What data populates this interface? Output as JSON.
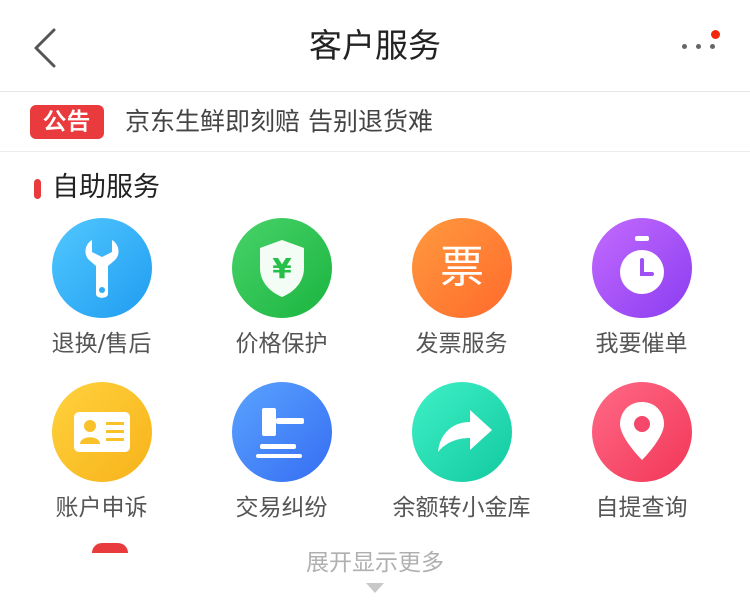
{
  "header": {
    "title": "客户服务",
    "back_icon": "chevron-left-icon",
    "more_icon": "more-dots-icon",
    "badge_color": "#f2270c"
  },
  "notice": {
    "tag": "公告",
    "text": "京东生鲜即刻赔 告别退货难",
    "tag_color": "#e93b3d"
  },
  "section": {
    "title": "自助服务",
    "accent_color": "#e93b3d"
  },
  "services": [
    {
      "label": "退换/售后",
      "icon": "wrench-icon",
      "color": "#2fadf5"
    },
    {
      "label": "价格保护",
      "icon": "shield-yuan-icon",
      "color": "#26bf4a"
    },
    {
      "label": "发票服务",
      "icon": "invoice-icon",
      "color": "#ff7a30",
      "glyph": "票"
    },
    {
      "label": "我要催单",
      "icon": "stopwatch-icon",
      "color": "#a150f5"
    },
    {
      "label": "账户申诉",
      "icon": "id-card-icon",
      "color": "#f9c12a"
    },
    {
      "label": "交易纠纷",
      "icon": "gavel-icon",
      "color": "#3f82f5"
    },
    {
      "label": "余额转小金库",
      "icon": "share-arrow-icon",
      "color": "#1bd4aa"
    },
    {
      "label": "自提查询",
      "icon": "location-pin-icon",
      "color": "#f5476a"
    }
  ],
  "footer": {
    "expand_text": "展开显示更多",
    "expand_icon": "triangle-down-icon"
  }
}
